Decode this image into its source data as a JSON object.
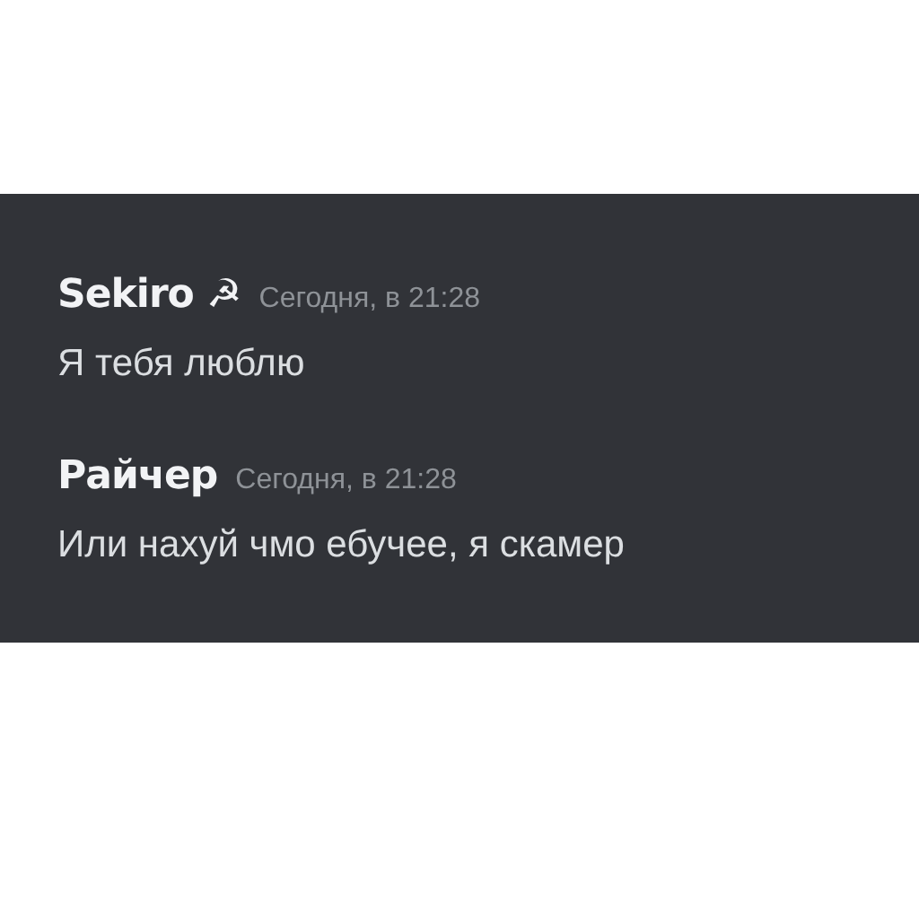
{
  "messages": [
    {
      "author": "Sekiro ☭",
      "timestamp": "Сегодня, в 21:28",
      "text": "Я тебя люблю"
    },
    {
      "author": "Райчер",
      "timestamp": "Сегодня, в 21:28",
      "text": "Или нахуй чмо ебучее, я скамер"
    }
  ]
}
